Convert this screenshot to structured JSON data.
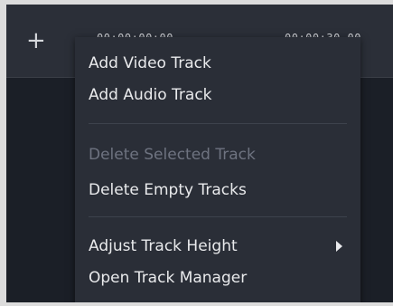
{
  "ruler": {
    "add_button_symbol": "+",
    "timecode_left": "00:00:00:00",
    "timecode_right": "00:00:30.00"
  },
  "menu": {
    "items": [
      {
        "label": "Add Video Track",
        "enabled": true
      },
      {
        "label": "Add Audio Track",
        "enabled": true
      },
      {
        "label": "Delete Selected Track",
        "enabled": false
      },
      {
        "label": "Delete Empty Tracks",
        "enabled": true
      },
      {
        "label": "Adjust Track Height",
        "enabled": true,
        "has_submenu": true
      },
      {
        "label": "Open Track Manager",
        "enabled": true
      }
    ]
  },
  "colors": {
    "background": "#1b1f27",
    "menu_background": "#2a2e37",
    "text": "#e9eaec",
    "disabled_text": "#6e7380"
  }
}
